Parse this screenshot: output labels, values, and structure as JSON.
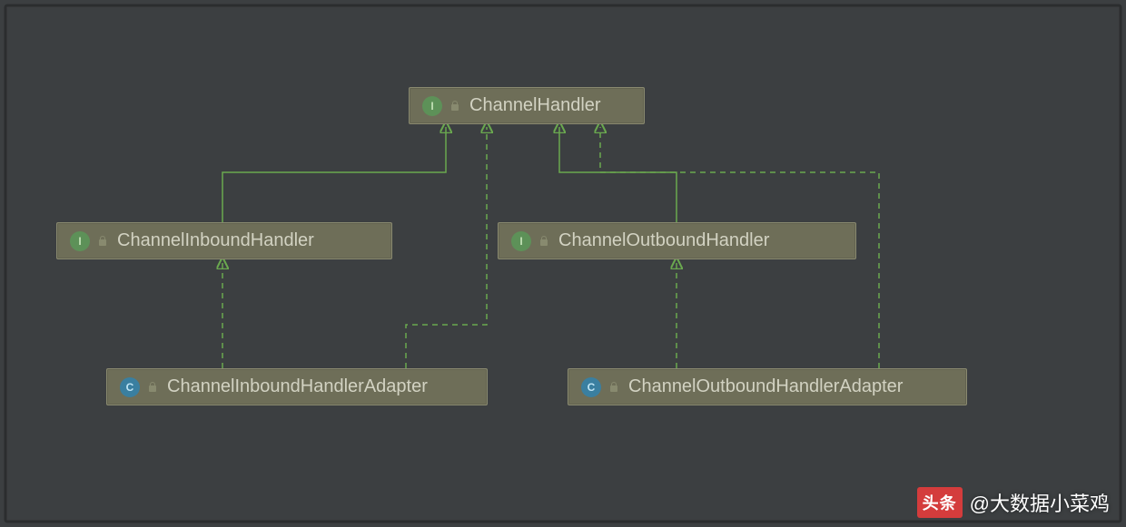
{
  "nodes": {
    "root": {
      "label": "ChannelHandler",
      "kind": "I"
    },
    "inH": {
      "label": "ChannelInboundHandler",
      "kind": "I"
    },
    "outH": {
      "label": "ChannelOutboundHandler",
      "kind": "I"
    },
    "inAdp": {
      "label": "ChannelInboundHandlerAdapter",
      "kind": "C"
    },
    "outAdp": {
      "label": "ChannelOutboundHandlerAdapter",
      "kind": "C"
    }
  },
  "watermark": {
    "logo": "头条",
    "text": "@大数据小菜鸡"
  },
  "colors": {
    "bg": "#3c3f41",
    "nodeFill": "#6e6e58",
    "label": "#d2d2c2",
    "connector": "#6aa84f",
    "interfaceBadge": "#5d9158",
    "classBadge": "#3a7fa0"
  }
}
